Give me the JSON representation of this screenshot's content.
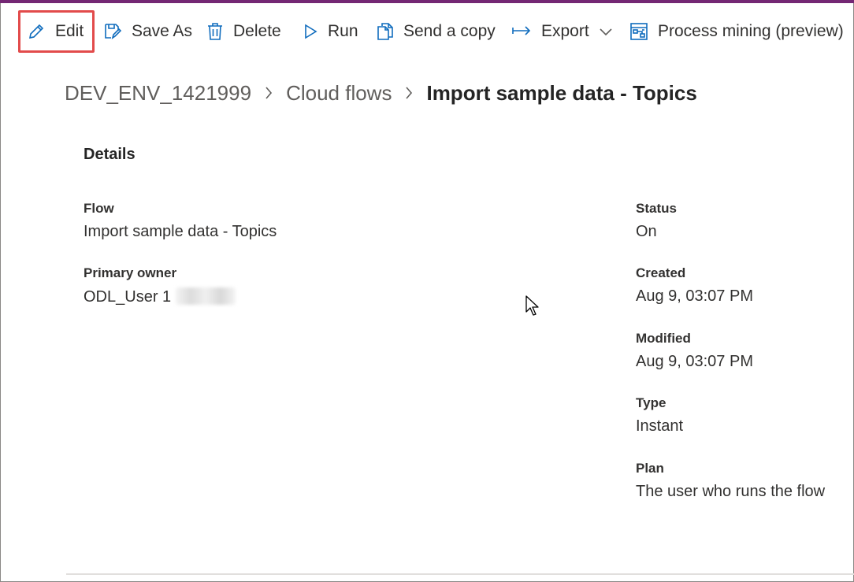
{
  "toolbar": {
    "edit": "Edit",
    "save_as": "Save As",
    "delete": "Delete",
    "run": "Run",
    "send_copy": "Send a copy",
    "export": "Export",
    "process_mining": "Process mining (preview)"
  },
  "breadcrumb": {
    "environment": "DEV_ENV_1421999",
    "section": "Cloud flows",
    "current": "Import sample data - Topics"
  },
  "details": {
    "title": "Details",
    "flow_label": "Flow",
    "flow_value": "Import sample data - Topics",
    "owner_label": "Primary owner",
    "owner_value": "ODL_User 1",
    "status_label": "Status",
    "status_value": "On",
    "created_label": "Created",
    "created_value": "Aug 9, 03:07 PM",
    "modified_label": "Modified",
    "modified_value": "Aug 9, 03:07 PM",
    "type_label": "Type",
    "type_value": "Instant",
    "plan_label": "Plan",
    "plan_value": "The user who runs the flow"
  },
  "colors": {
    "accent": "#742774",
    "icon_blue": "#0f6cbd",
    "highlight": "#e24b4b"
  }
}
